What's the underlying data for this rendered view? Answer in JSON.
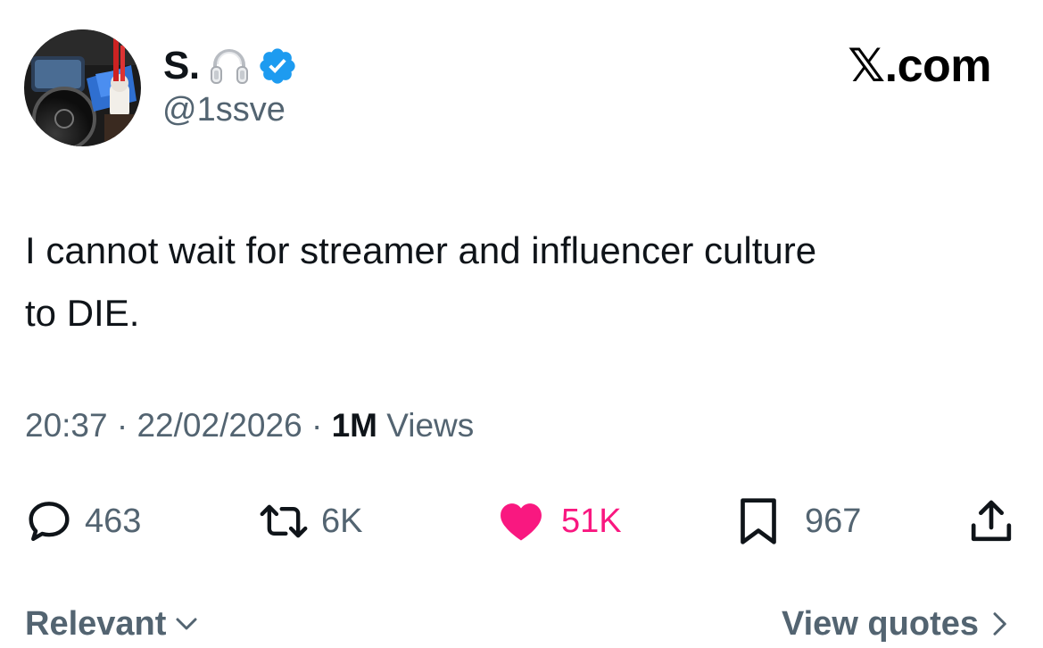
{
  "author": {
    "display_name": "S.",
    "handle": "@1ssve",
    "avatar_icon": "profile-photo",
    "badges": [
      "headphones-emoji-icon",
      "verified-badge-icon"
    ]
  },
  "brand": {
    "label": "𝕏.com"
  },
  "tweet": {
    "line1": "I cannot wait for streamer and influencer culture",
    "line2": "to DIE.",
    "time": "20:37",
    "separator": "·",
    "date": "22/02/2026",
    "views_count": "1M",
    "views_label": "Views"
  },
  "actions": {
    "replies": "463",
    "reposts": "6K",
    "likes": "51K",
    "bookmarks": "967"
  },
  "footer": {
    "sort_label": "Relevant",
    "quotes_label": "View quotes"
  },
  "colors": {
    "text": "#0f1419",
    "secondary": "#536471",
    "like": "#f91880",
    "verified": "#1d9bf0"
  }
}
